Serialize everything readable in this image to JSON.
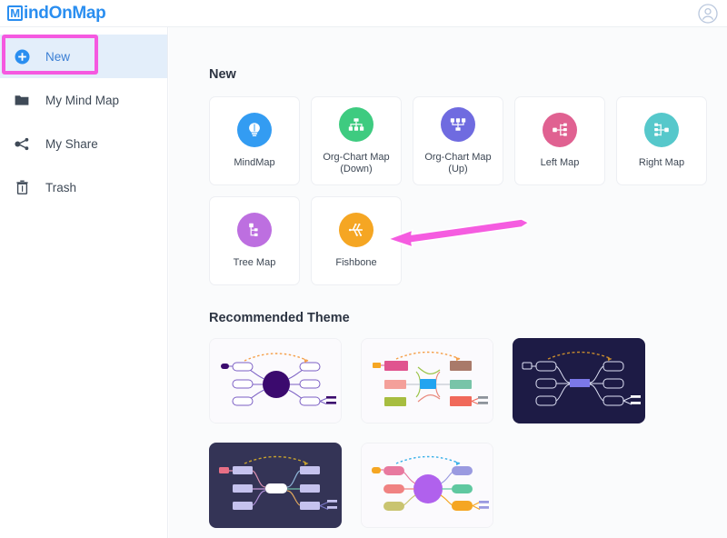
{
  "app": {
    "logo_mark": "M",
    "logo_text": "indOnMap",
    "avatar_icon": "user-circle-icon"
  },
  "sidebar": {
    "items": [
      {
        "label": "New",
        "icon": "plus-circle-icon",
        "active": true
      },
      {
        "label": "My Mind Map",
        "icon": "folder-icon",
        "active": false
      },
      {
        "label": "My Share",
        "icon": "share-icon",
        "active": false
      },
      {
        "label": "Trash",
        "icon": "trash-icon",
        "active": false
      }
    ]
  },
  "main": {
    "new_section_title": "New",
    "theme_section_title": "Recommended Theme",
    "templates": [
      {
        "label": "MindMap",
        "icon": "lightbulb-icon",
        "color": "#339cf2"
      },
      {
        "label": "Org-Chart Map (Down)",
        "icon": "org-chart-down-icon",
        "color": "#3ecb80"
      },
      {
        "label": "Org-Chart Map (Up)",
        "icon": "org-chart-up-icon",
        "color": "#6f6be0"
      },
      {
        "label": "Left Map",
        "icon": "left-map-icon",
        "color": "#e06191"
      },
      {
        "label": "Right Map",
        "icon": "right-map-icon",
        "color": "#56c8cb"
      },
      {
        "label": "Tree Map",
        "icon": "tree-map-icon",
        "color": "#bd6fe0"
      },
      {
        "label": "Fishbone",
        "icon": "fishbone-icon",
        "color": "#f5a623"
      }
    ],
    "themes": [
      {
        "name": "theme-purple-light",
        "style": "light"
      },
      {
        "name": "theme-colorful-light",
        "style": "light"
      },
      {
        "name": "theme-blue-dark",
        "style": "dark"
      },
      {
        "name": "theme-pastel-dark",
        "style": "dark"
      },
      {
        "name": "theme-violet-light",
        "style": "light"
      }
    ]
  },
  "annotations": {
    "highlight_box": {
      "target": "New",
      "color": "#f559e0"
    },
    "arrow": {
      "target": "Fishbone",
      "color": "#f55ce0",
      "direction": "left"
    }
  }
}
